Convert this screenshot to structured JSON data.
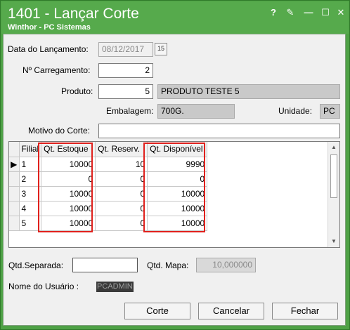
{
  "window": {
    "title": "1401 - Lançar Corte",
    "subtitle": "Winthor - PC Sistemas",
    "controls": {
      "help": "?",
      "edit": "✎",
      "minimize": "—",
      "maximize": "☐",
      "close": "✕"
    }
  },
  "form": {
    "data_lancamento_label": "Data do Lançamento:",
    "data_lancamento_value": "08/12/2017",
    "carregamento_label": "Nº Carregamento:",
    "carregamento_value": "2",
    "produto_label": "Produto:",
    "produto_code": "5",
    "produto_desc": "PRODUTO TESTE 5",
    "embalagem_label": "Embalagem:",
    "embalagem_value": "700G.",
    "unidade_label": "Unidade:",
    "unidade_value": "PC",
    "motivo_label": "Motivo do Corte:",
    "motivo_value": ""
  },
  "grid": {
    "columns": [
      "Filial",
      "Qt. Estoque",
      "Qt. Reserv.",
      "Qt. Disponível"
    ],
    "row_indicator": "▶",
    "rows": [
      {
        "filial": "1",
        "estoque": "10000",
        "reserv": "10",
        "disp": "9990"
      },
      {
        "filial": "2",
        "estoque": "0",
        "reserv": "0",
        "disp": "0"
      },
      {
        "filial": "3",
        "estoque": "10000",
        "reserv": "0",
        "disp": "10000"
      },
      {
        "filial": "4",
        "estoque": "10000",
        "reserv": "0",
        "disp": "10000"
      },
      {
        "filial": "5",
        "estoque": "10000",
        "reserv": "0",
        "disp": "10000"
      }
    ]
  },
  "bottom": {
    "qtd_separada_label": "Qtd.Separada:",
    "qtd_separada_value": "",
    "qtd_mapa_label": "Qtd. Mapa:",
    "qtd_mapa_value": "10,000000",
    "usuario_label": "Nome do Usuário :",
    "usuario_value": "PCADMIN"
  },
  "buttons": {
    "corte": "Corte",
    "cancelar": "Cancelar",
    "fechar": "Fechar"
  },
  "colors": {
    "title_bar": "#56aa4c",
    "highlight": "#e0201c"
  }
}
